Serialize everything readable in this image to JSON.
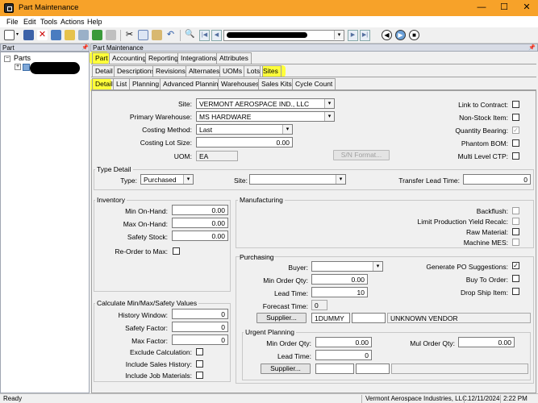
{
  "window": {
    "title": "Part Maintenance",
    "min": "—",
    "max": "☐",
    "close": "✕"
  },
  "menu": [
    "File",
    "Edit",
    "Tools",
    "Actions",
    "Help"
  ],
  "toolbar": {
    "icons": [
      "new-icon",
      "save-icon",
      "delete-icon",
      "grid-icon",
      "open-icon",
      "print-icon",
      "refresh-icon",
      "attach-icon",
      "cut-icon",
      "copy-icon",
      "paste-icon",
      "undo-icon",
      "find-icon",
      "first-icon",
      "prev-icon",
      "next-icon",
      "last-icon",
      "back-icon",
      "forward-icon",
      "stop-icon"
    ],
    "nav_first": "|◀",
    "nav_prev": "◀",
    "nav_next": "▶",
    "nav_last": "▶|",
    "back": "◀",
    "forward": "▶",
    "stop": "■"
  },
  "tree": {
    "header": "Part",
    "root": "Parts",
    "expander": "−",
    "child_expander": "+"
  },
  "main_header": "Part Maintenance",
  "tabs_top": [
    "Part",
    "Accounting",
    "Reporting",
    "Integrations",
    "Attributes"
  ],
  "tabs_second": [
    "Detail",
    "Descriptions",
    "Revisions",
    "Alternates",
    "UOMs",
    "Lots",
    "Sites"
  ],
  "tabs_third": [
    "Detail",
    "List",
    "Planning",
    "Advanced Planning",
    "Warehouses",
    "Sales Kits",
    "Cycle Count"
  ],
  "top_form": {
    "site_label": "Site:",
    "site_value": "VERMONT AEROSPACE IND., LLC",
    "primary_warehouse_label": "Primary Warehouse:",
    "primary_warehouse_value": "MS HARDWARE",
    "costing_method_label": "Costing Method:",
    "costing_method_value": "Last",
    "costing_lot_size_label": "Costing Lot Size:",
    "costing_lot_size_value": "0.00",
    "uom_label": "UOM:",
    "uom_value": "EA",
    "sn_format_button": "S/N Format...",
    "link_to_contract": "Link to Contract:",
    "non_stock_item": "Non-Stock Item:",
    "quantity_bearing": "Quantity Bearing:",
    "phantom_bom": "Phantom BOM:",
    "multi_level_ctp": "Multi Level CTP:",
    "check_mark": "✓"
  },
  "type_detail": {
    "title": "Type Detail",
    "type_label": "Type:",
    "type_value": "Purchased",
    "site_label": "Site:",
    "site_value": "",
    "transfer_lead_time_label": "Transfer Lead Time:",
    "transfer_lead_time_value": "0"
  },
  "inventory": {
    "title": "Inventory",
    "min_on_hand_label": "Min On-Hand:",
    "min_on_hand_value": "0.00",
    "max_on_hand_label": "Max On-Hand:",
    "max_on_hand_value": "0.00",
    "safety_stock_label": "Safety Stock:",
    "safety_stock_value": "0.00",
    "reorder_to_max_label": "Re-Order to Max:"
  },
  "manufacturing": {
    "title": "Manufacturing",
    "backflush": "Backflush:",
    "limit_production_yield": "Limit Production Yield Recalc:",
    "raw_material": "Raw Material:",
    "machine_mes": "Machine MES:"
  },
  "purchasing": {
    "title": "Purchasing",
    "buyer_label": "Buyer:",
    "buyer_value": "",
    "min_order_qty_label": "Min Order Qty:",
    "min_order_qty_value": "0.00",
    "lead_time_label": "Lead Time:",
    "lead_time_value": "10",
    "forecast_time_label": "Forecast Time:",
    "forecast_time_value": "0",
    "supplier_button": "Supplier...",
    "supplier_id": "1DUMMY",
    "supplier_name": "UNKNOWN VENDOR",
    "generate_po_suggestions": "Generate PO Suggestions:",
    "buy_to_order": "Buy To Order:",
    "drop_ship_item": "Drop Ship Item:",
    "check_mark": "✓"
  },
  "urgent_planning": {
    "title": "Urgent Planning",
    "min_order_qty_label": "Min Order Qty:",
    "min_order_qty_value": "0.00",
    "lead_time_label": "Lead Time:",
    "lead_time_value": "0",
    "mul_order_qty_label": "Mul Order Qty:",
    "mul_order_qty_value": "0.00",
    "supplier_button": "Supplier..."
  },
  "calc": {
    "title": "Calculate Min/Max/Safety Values",
    "history_window_label": "History Window:",
    "history_window_value": "0",
    "safety_factor_label": "Safety Factor:",
    "safety_factor_value": "0",
    "max_factor_label": "Max Factor:",
    "max_factor_value": "0",
    "exclude_calculation": "Exclude Calculation:",
    "include_sales_history": "Include Sales History:",
    "include_job_materials": "Include Job Materials:"
  },
  "status": {
    "ready": "Ready",
    "company": "Vermont Aerospace Industries, LLC.",
    "date": "12/11/2024",
    "time": "2:22 PM"
  },
  "combo_arrow": "▾",
  "colors": {
    "title_bar": "#f7a229",
    "highlight": "#ffff3a"
  }
}
